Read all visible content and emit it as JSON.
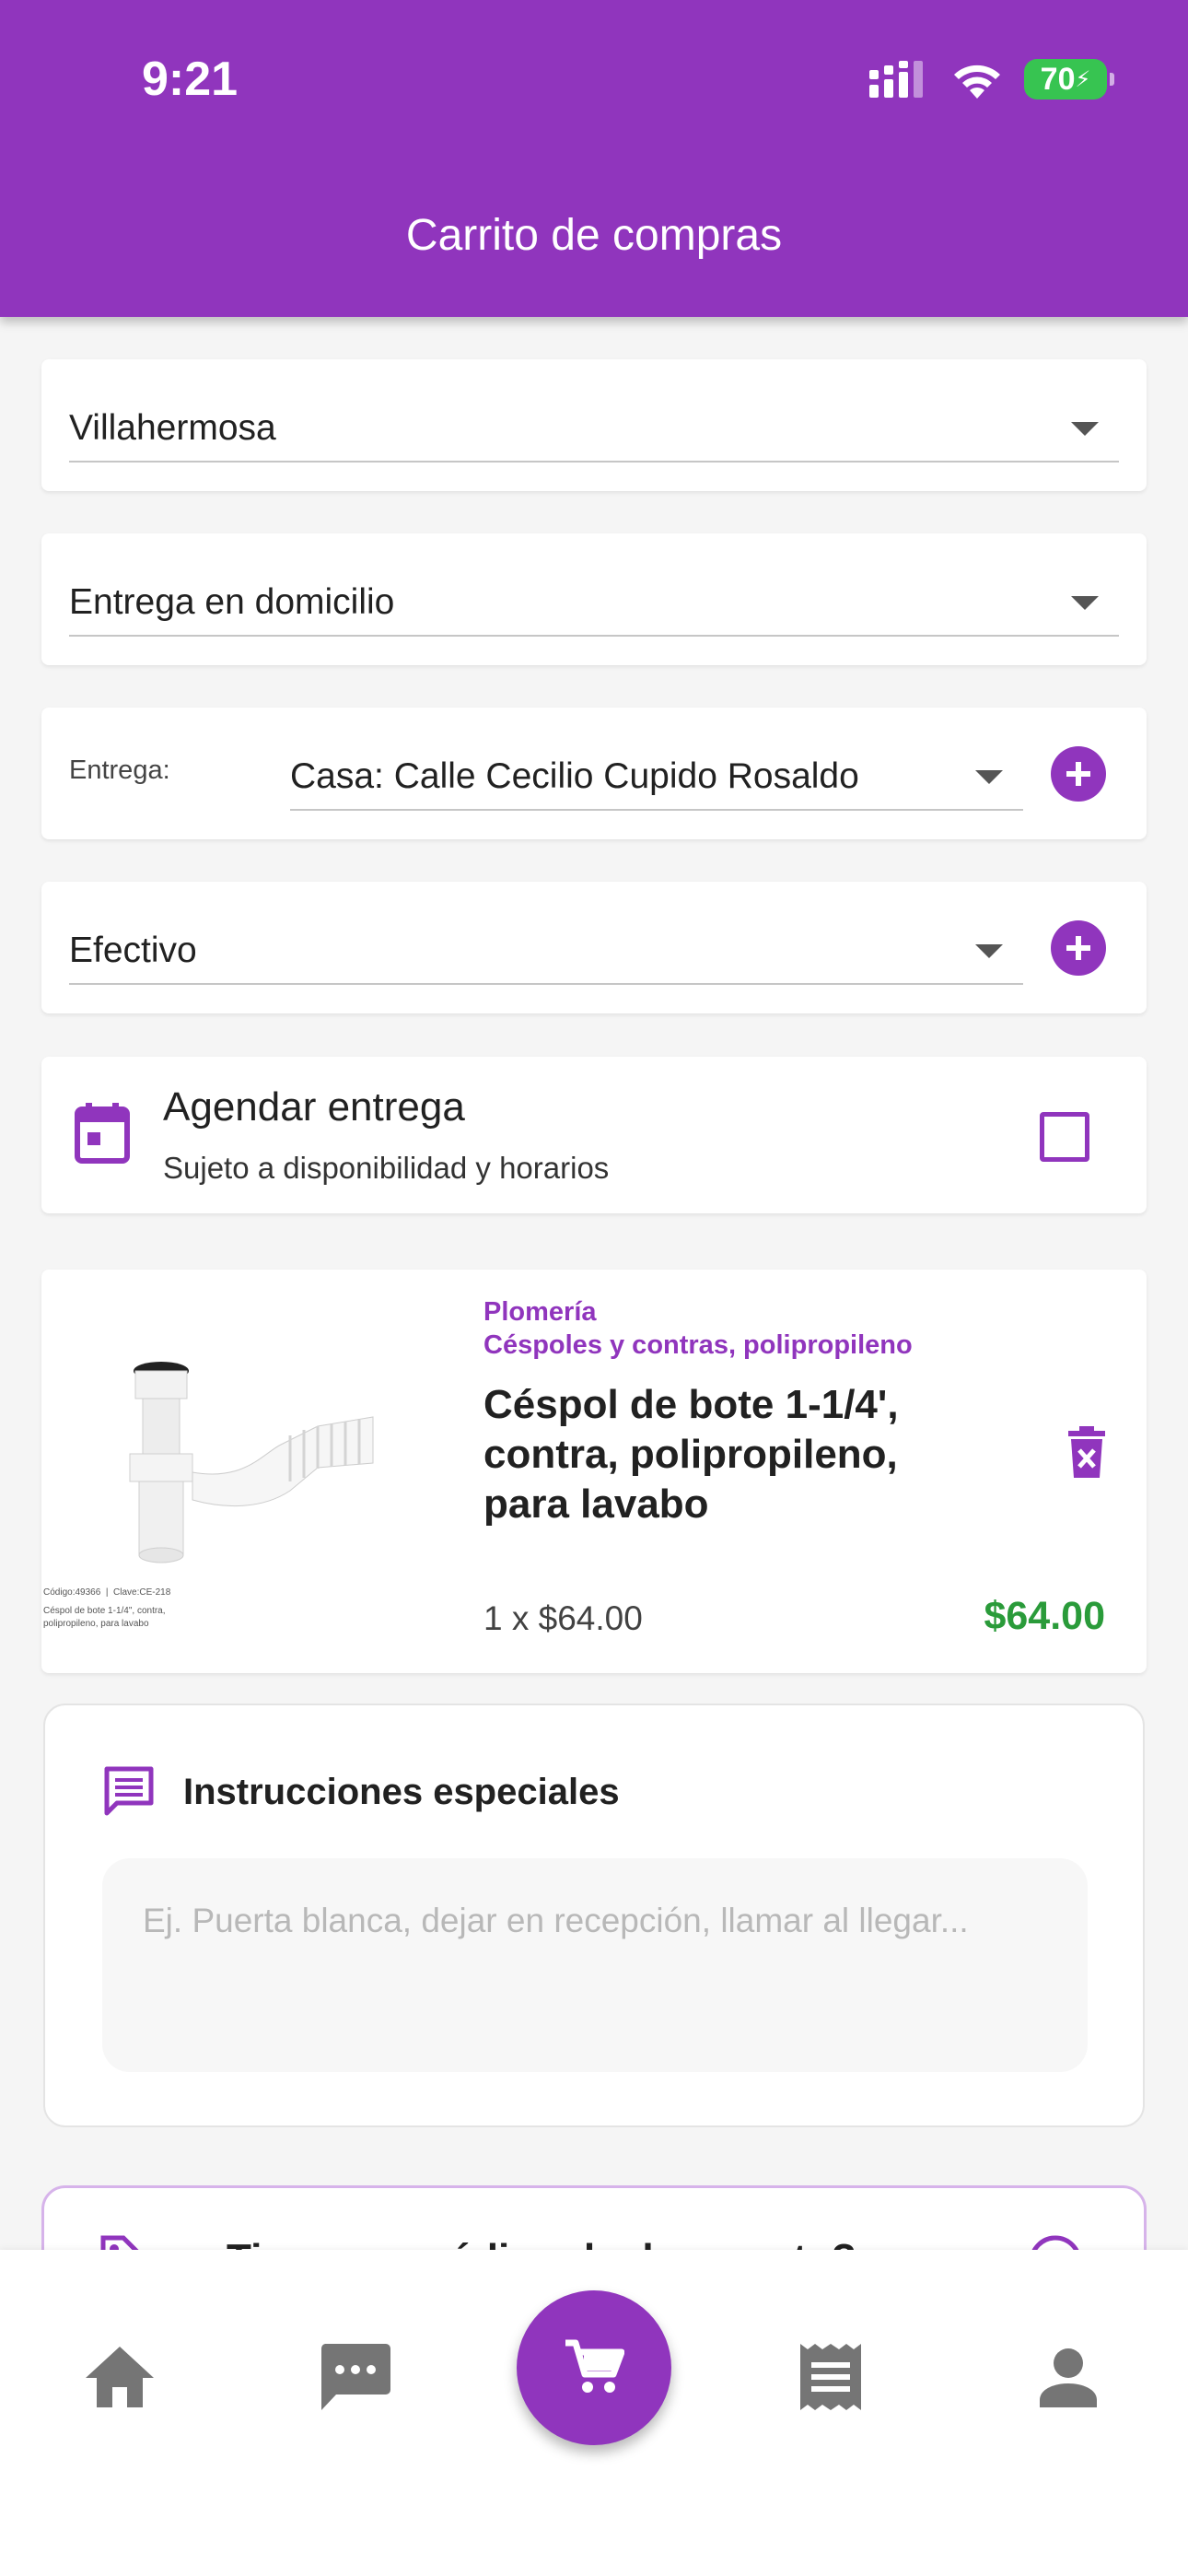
{
  "status_bar": {
    "time": "9:21",
    "battery": "70"
  },
  "header": {
    "title": "Carrito de compras"
  },
  "form": {
    "city": "Villahermosa",
    "delivery_method": "Entrega en domicilio",
    "address_label": "Entrega:",
    "address": "Casa: Calle Cecilio Cupido Rosaldo",
    "payment": "Efectivo"
  },
  "schedule": {
    "title": "Agendar entrega",
    "subtitle": "Sujeto a disponibilidad y horarios",
    "checked": false
  },
  "cart_item": {
    "category": "Plomería",
    "subcategory": "Céspoles y contras, polipropileno",
    "name": "Céspol de bote 1-1/4', contra, polipropileno, para lavabo",
    "quantity_text": "1 x $64.00",
    "total": "$64.00",
    "image_code": "Código:49366",
    "image_key": "Clave:CE-218",
    "image_caption": "Céspol de bote 1-1/4\", contra, polipropileno, para lavabo"
  },
  "instructions": {
    "title": "Instrucciones especiales",
    "placeholder": "Ej. Puerta blanca, dejar en recepción, llamar al llegar..."
  },
  "promo": {
    "text": "Tienes un código de descuento?"
  },
  "bottom_nav": {
    "items": [
      {
        "icon": "home-icon"
      },
      {
        "icon": "chat-icon"
      },
      {
        "icon": "cart-icon",
        "active": true
      },
      {
        "icon": "receipt-icon"
      },
      {
        "icon": "person-icon"
      }
    ]
  },
  "colors": {
    "primary": "#9035bd",
    "price": "#2a9b3a"
  }
}
